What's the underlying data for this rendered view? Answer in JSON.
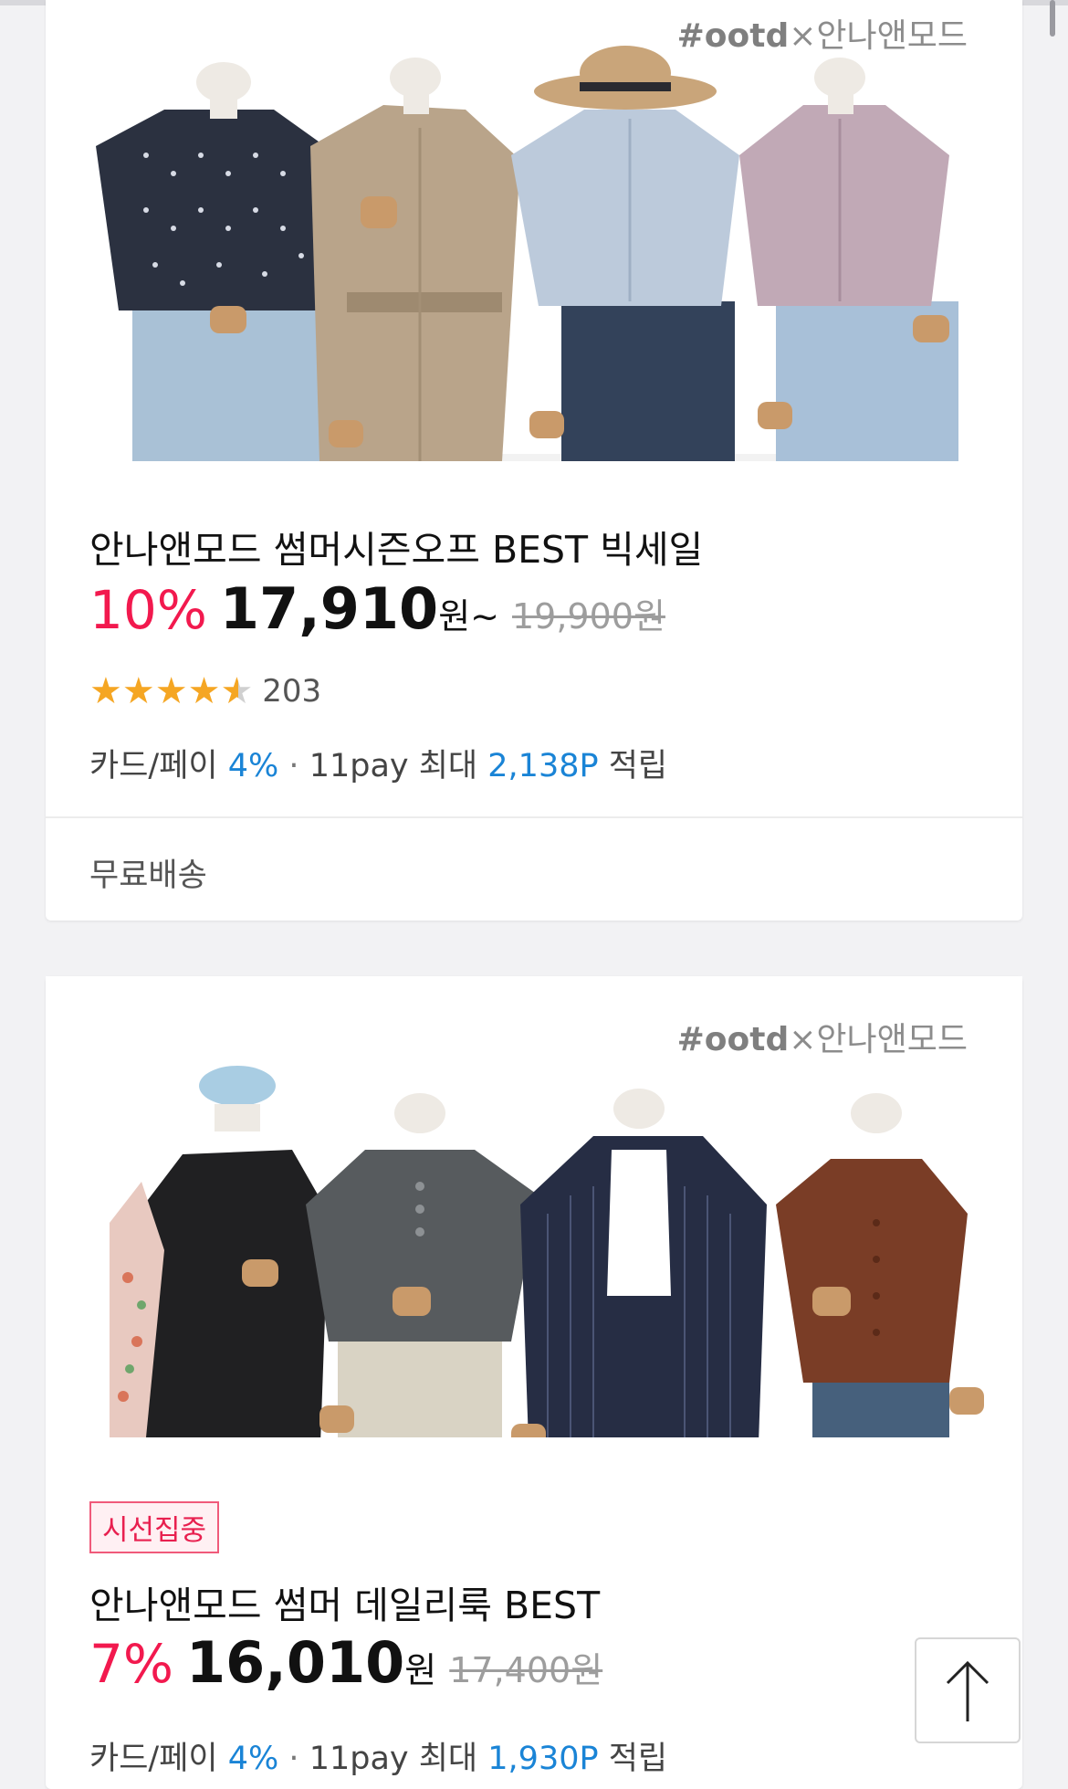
{
  "products": [
    {
      "watermark_brand": "#ootd",
      "watermark_sep": "×",
      "watermark_shop": "안나앤모드",
      "title": "안나앤모드 썸머시즌오프 BEST 빅세일",
      "discount": "10%",
      "price": "17,910",
      "price_unit": "원~",
      "original_price": "19,900원",
      "rating": 4.5,
      "review_count": "203",
      "benefit": {
        "card_label": "카드/페이",
        "card_rate": "4%",
        "sep": "·",
        "pay_label": "11pay 최대",
        "points": "2,138P",
        "suffix": "적립"
      },
      "shipping": "무료배송"
    },
    {
      "watermark_brand": "#ootd",
      "watermark_sep": "×",
      "watermark_shop": "안나앤모드",
      "badge": "시선집중",
      "title": "안나앤모드 썸머 데일리룩 BEST",
      "discount": "7%",
      "price": "16,010",
      "price_unit": "원",
      "original_price": "17,400원",
      "benefit": {
        "card_label": "카드/페이",
        "card_rate": "4%",
        "sep": "·",
        "pay_label": "11pay 최대",
        "points": "1,930P",
        "suffix": "적립"
      }
    }
  ],
  "scroll_top_icon": "arrow-up-icon",
  "colors": {
    "discount": "#f2194e",
    "point_blue": "#1a84d6",
    "star": "#f5a623",
    "background": "#f2f2f4"
  }
}
